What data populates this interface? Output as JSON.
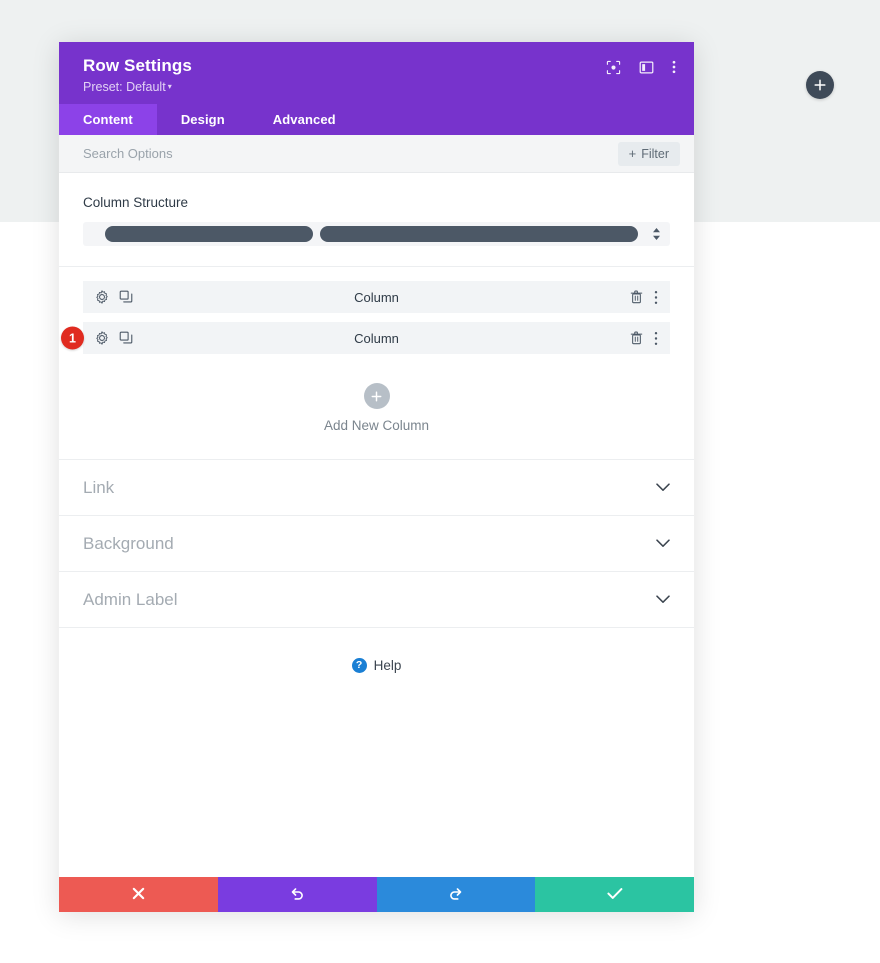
{
  "page": {
    "floating_add_button": {
      "label": "+",
      "icon": "plus-icon"
    },
    "background_top_color": "#eef1f1",
    "background_bottom_color": "#ffffff"
  },
  "modal": {
    "header": {
      "title": "Row Settings",
      "preset_label": "Preset: Default",
      "preset_caret": "▾",
      "background_color": "#7733cc",
      "icons": [
        {
          "name": "focus-icon",
          "title": "Focus"
        },
        {
          "name": "layout-panel-icon",
          "title": "Layout"
        },
        {
          "name": "more-vertical-icon",
          "title": "More"
        }
      ]
    },
    "tabs": [
      {
        "label": "Content",
        "active": true
      },
      {
        "label": "Design",
        "active": false
      },
      {
        "label": "Advanced",
        "active": false
      }
    ],
    "search": {
      "placeholder": "Search Options",
      "value": "",
      "filter_label": "Filter",
      "filter_plus": "+"
    },
    "column_structure": {
      "label": "Column Structure",
      "bars": [
        {
          "width_ratio": 0.38
        },
        {
          "width_ratio": 0.6
        }
      ],
      "bar_color": "#4c5866"
    },
    "columns": [
      {
        "name": "Column",
        "badge": null,
        "left_icons": [
          "gear-icon",
          "duplicate-icon"
        ],
        "right_icons": [
          "trash-icon",
          "more-vertical-icon"
        ]
      },
      {
        "name": "Column",
        "badge": "1",
        "badge_color": "#e02b20",
        "left_icons": [
          "gear-icon",
          "duplicate-icon"
        ],
        "right_icons": [
          "trash-icon",
          "more-vertical-icon"
        ]
      }
    ],
    "add_new_column": {
      "label": "Add New Column",
      "icon": "plus-icon"
    },
    "sections": [
      {
        "title": "Link",
        "expanded": false
      },
      {
        "title": "Background",
        "expanded": false
      },
      {
        "title": "Admin Label",
        "expanded": false
      }
    ],
    "help": {
      "label": "Help",
      "icon": "question-circle-icon",
      "icon_color": "#1a7fd4"
    },
    "footer": [
      {
        "name": "cancel-button",
        "icon": "close-icon",
        "color": "#ed5a53"
      },
      {
        "name": "undo-button",
        "icon": "undo-icon",
        "color": "#7a3ce0"
      },
      {
        "name": "redo-button",
        "icon": "redo-icon",
        "color": "#2b8adb"
      },
      {
        "name": "save-button",
        "icon": "check-icon",
        "color": "#2bc4a2"
      }
    ]
  }
}
